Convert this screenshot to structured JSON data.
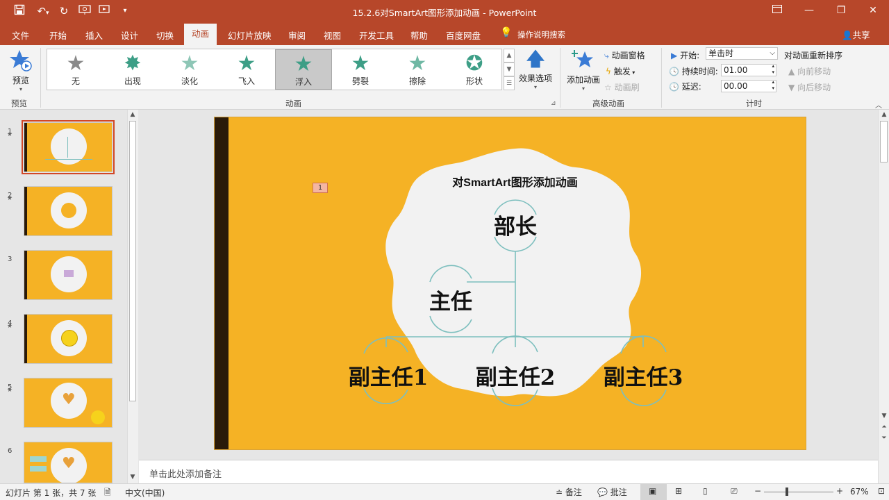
{
  "app": {
    "title": "15.2.6对SmartArt图形添加动画  -  PowerPoint",
    "share": "共享",
    "tell_me": "操作说明搜索"
  },
  "colors": {
    "accent": "#b7472a",
    "slide_bg": "#f5b225",
    "slide_bar": "#2a1a09",
    "connector": "#7dbfbe",
    "star_gray": "#8a8a8a",
    "star_green": "#3d9e86"
  },
  "menu_tabs": [
    "文件",
    "开始",
    "插入",
    "设计",
    "切换",
    "动画",
    "幻灯片放映",
    "审阅",
    "视图",
    "开发工具",
    "帮助",
    "百度网盘"
  ],
  "active_tab": "动画",
  "ribbon": {
    "preview": {
      "label": "预览",
      "group": "预览"
    },
    "animation_group": "动画",
    "effects": [
      {
        "label": "无",
        "icon": "star-gray-icon"
      },
      {
        "label": "出现",
        "icon": "star-burst-green-icon"
      },
      {
        "label": "淡化",
        "icon": "star-fade-green-icon"
      },
      {
        "label": "飞入",
        "icon": "star-fly-green-icon"
      },
      {
        "label": "浮入",
        "icon": "star-float-green-icon",
        "selected": true
      },
      {
        "label": "劈裂",
        "icon": "star-split-green-icon"
      },
      {
        "label": "擦除",
        "icon": "star-wipe-green-icon"
      },
      {
        "label": "形状",
        "icon": "star-shape-green-icon"
      }
    ],
    "effect_options": "效果选项",
    "add_animation": "添加动画",
    "animation_pane": "动画窗格",
    "trigger": "触发",
    "animation_painter": "动画刷",
    "advanced_group": "高级动画",
    "timing": {
      "start_label": "开始:",
      "start_value": "单击时",
      "duration_label": "持续时间:",
      "duration_value": "01.00",
      "delay_label": "延迟:",
      "delay_value": "00.00",
      "group": "计时"
    },
    "reorder": {
      "title": "对动画重新排序",
      "move_earlier": "向前移动",
      "move_later": "向后移动"
    }
  },
  "thumbnails": [
    {
      "num": "1",
      "star": "★",
      "selected": true
    },
    {
      "num": "2",
      "star": "★"
    },
    {
      "num": "3",
      "star": ""
    },
    {
      "num": "4",
      "star": "★"
    },
    {
      "num": "5",
      "star": "★"
    },
    {
      "num": "6",
      "star": ""
    }
  ],
  "slide": {
    "title": "对SmartArt图形添加动画",
    "anim_tag": "1",
    "nodes": {
      "top": "部长",
      "assistant": "主任",
      "sub1": "副主任1",
      "sub2": "副主任2",
      "sub3": "副主任3"
    }
  },
  "notes_placeholder": "单击此处添加备注",
  "status": {
    "slide_info": "幻灯片 第 1 张，共 7 张",
    "language": "中文(中国)",
    "notes": "备注",
    "comments": "批注",
    "zoom": "67%"
  }
}
